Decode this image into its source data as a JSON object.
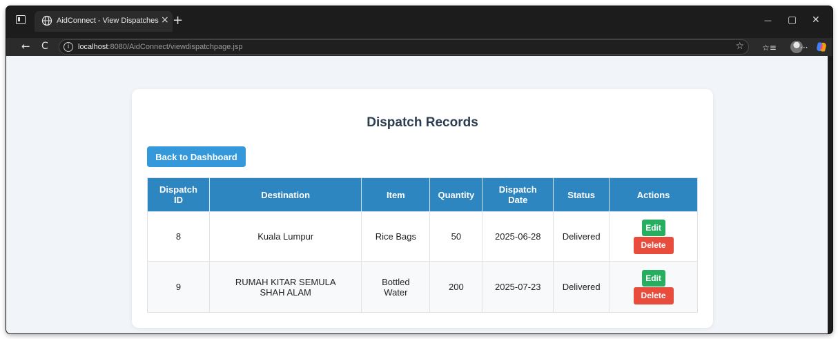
{
  "browser": {
    "tab_title": "AidConnect - View Dispatches",
    "tab_close": "×",
    "new_tab": "+",
    "url_host": "localhost",
    "url_rest": ":8080/AidConnect/viewdispatchpage.jsp",
    "window_controls": {
      "minimize": "—",
      "maximize": "▢",
      "close": "✕"
    },
    "toolbar": {
      "back": "←",
      "refresh": "C",
      "star": "☆",
      "favorites": "☆≡",
      "more": "···"
    }
  },
  "page": {
    "title": "Dispatch Records",
    "back_button": "Back to Dashboard",
    "table": {
      "headers": {
        "dispatch_id_line1": "Dispatch",
        "dispatch_id_line2": "ID",
        "destination": "Destination",
        "item": "Item",
        "quantity": "Quantity",
        "dispatch_date_line1": "Dispatch",
        "dispatch_date_line2": "Date",
        "status": "Status",
        "actions": "Actions"
      },
      "rows": [
        {
          "id": "8",
          "destination": "Kuala Lumpur",
          "item": "Rice Bags",
          "quantity": "50",
          "date": "2025-06-28",
          "status": "Delivered",
          "edit": "Edit",
          "delete": "Delete"
        },
        {
          "id": "9",
          "destination": "RUMAH KITAR SEMULA SHAH ALAM",
          "item": "Bottled Water",
          "quantity": "200",
          "date": "2025-07-23",
          "status": "Delivered",
          "edit": "Edit",
          "delete": "Delete"
        }
      ]
    }
  },
  "colors": {
    "primary": "#3498db",
    "table_header": "#2e86c1",
    "edit": "#27ae60",
    "delete": "#e74c3c",
    "title": "#2c3e50",
    "page_bg": "#f1f5f9"
  }
}
